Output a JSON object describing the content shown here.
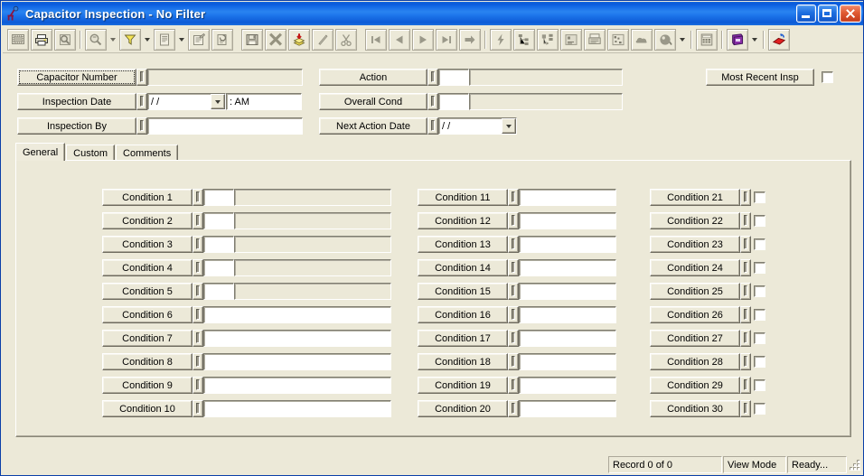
{
  "window": {
    "title": "Capacitor Inspection - No Filter",
    "app_icon": "capacitor-icon",
    "minimize_label": "Minimize",
    "maximize_label": "Maximize",
    "close_label": "Close"
  },
  "toolbar": {
    "buttons": [
      {
        "name": "screen-icon",
        "tip": "Screen"
      },
      {
        "name": "print-icon",
        "tip": "Print"
      },
      {
        "name": "print-preview-icon",
        "tip": "Print Preview"
      },
      {
        "name": "find-icon",
        "tip": "Find"
      },
      {
        "name": "filter-icon",
        "tip": "Filter"
      },
      {
        "name": "report-icon",
        "tip": "Report"
      },
      {
        "name": "properties-icon",
        "tip": "Properties"
      },
      {
        "name": "refresh-icon",
        "tip": "Refresh"
      },
      {
        "name": "save-icon",
        "tip": "Save"
      },
      {
        "name": "delete-icon",
        "tip": "Delete"
      },
      {
        "name": "add-record-icon",
        "tip": "Add Record"
      },
      {
        "name": "edit-icon",
        "tip": "Edit"
      },
      {
        "name": "cut-icon",
        "tip": "Cut"
      },
      {
        "name": "first-record-icon",
        "tip": "First Record"
      },
      {
        "name": "previous-record-icon",
        "tip": "Previous Record"
      },
      {
        "name": "next-record-icon",
        "tip": "Next Record"
      },
      {
        "name": "last-record-icon",
        "tip": "Last Record"
      },
      {
        "name": "goto-record-icon",
        "tip": "Go To Record"
      },
      {
        "name": "lightning-icon",
        "tip": "Run"
      },
      {
        "name": "tree-view-icon",
        "tip": "Tree View"
      },
      {
        "name": "layout-icon",
        "tip": "Layout"
      },
      {
        "name": "list-icon",
        "tip": "List"
      },
      {
        "name": "fax-icon",
        "tip": "Fax"
      },
      {
        "name": "image-icon",
        "tip": "Image"
      },
      {
        "name": "cloud-icon",
        "tip": "Cloud"
      },
      {
        "name": "globe-icon",
        "tip": "Web"
      },
      {
        "name": "calculator-icon",
        "tip": "Calculator"
      },
      {
        "name": "book-icon",
        "tip": "Help Book"
      },
      {
        "name": "exit-icon",
        "tip": "Exit"
      }
    ]
  },
  "header": {
    "left_fields": [
      {
        "label": "Capacitor Number",
        "value": "",
        "focused": true,
        "type": "readonly"
      },
      {
        "label": "Inspection Date",
        "value": "  /  /",
        "time_value": "  :    AM",
        "type": "date-time"
      },
      {
        "label": "Inspection By",
        "value": "",
        "type": "text"
      }
    ],
    "middle_fields": [
      {
        "label": "Action",
        "code_value": "",
        "desc_value": "",
        "type": "code-desc"
      },
      {
        "label": "Overall Cond",
        "code_value": "",
        "desc_value": "",
        "type": "code-desc"
      },
      {
        "label": "Next Action Date",
        "value": "  /  /",
        "type": "date"
      }
    ],
    "most_recent": {
      "label": "Most Recent Insp",
      "checked": false
    }
  },
  "tabs": [
    {
      "label": "General",
      "active": true
    },
    {
      "label": "Custom",
      "active": false
    },
    {
      "label": "Comments",
      "active": false
    }
  ],
  "conditions": {
    "column1": [
      {
        "label": "Condition 1",
        "code_value": "",
        "desc_value": "",
        "style": "code-desc"
      },
      {
        "label": "Condition 2",
        "code_value": "",
        "desc_value": "",
        "style": "code-desc"
      },
      {
        "label": "Condition 3",
        "code_value": "",
        "desc_value": "",
        "style": "code-desc"
      },
      {
        "label": "Condition 4",
        "code_value": "",
        "desc_value": "",
        "style": "code-desc"
      },
      {
        "label": "Condition 5",
        "code_value": "",
        "desc_value": "",
        "style": "code-desc"
      },
      {
        "label": "Condition 6",
        "value": "",
        "style": "wide-text"
      },
      {
        "label": "Condition 7",
        "value": "",
        "style": "wide-text"
      },
      {
        "label": "Condition 8",
        "value": "",
        "style": "wide-text"
      },
      {
        "label": "Condition 9",
        "value": "",
        "style": "wide-text"
      },
      {
        "label": "Condition 10",
        "value": "",
        "style": "wide-text"
      }
    ],
    "column2": [
      {
        "label": "Condition 11",
        "value": "",
        "style": "text"
      },
      {
        "label": "Condition 12",
        "value": "",
        "style": "text"
      },
      {
        "label": "Condition 13",
        "value": "",
        "style": "text"
      },
      {
        "label": "Condition 14",
        "value": "",
        "style": "text"
      },
      {
        "label": "Condition 15",
        "value": "",
        "style": "text"
      },
      {
        "label": "Condition 16",
        "value": "",
        "style": "text"
      },
      {
        "label": "Condition 17",
        "value": "",
        "style": "text"
      },
      {
        "label": "Condition 18",
        "value": "",
        "style": "text"
      },
      {
        "label": "Condition 19",
        "value": "",
        "style": "text"
      },
      {
        "label": "Condition 20",
        "value": "",
        "style": "text"
      }
    ],
    "column3": [
      {
        "label": "Condition 21",
        "checked": false,
        "style": "checkbox"
      },
      {
        "label": "Condition 22",
        "checked": false,
        "style": "checkbox"
      },
      {
        "label": "Condition 23",
        "checked": false,
        "style": "checkbox"
      },
      {
        "label": "Condition 24",
        "checked": false,
        "style": "checkbox"
      },
      {
        "label": "Condition 25",
        "checked": false,
        "style": "checkbox"
      },
      {
        "label": "Condition 26",
        "checked": false,
        "style": "checkbox"
      },
      {
        "label": "Condition 27",
        "checked": false,
        "style": "checkbox"
      },
      {
        "label": "Condition 28",
        "checked": false,
        "style": "checkbox"
      },
      {
        "label": "Condition 29",
        "checked": false,
        "style": "checkbox"
      },
      {
        "label": "Condition 30",
        "checked": false,
        "style": "checkbox"
      }
    ]
  },
  "statusbar": {
    "record": "Record 0 of 0",
    "mode": "View Mode",
    "state": "Ready...",
    "grip": "resize-grip"
  },
  "colors": {
    "titlebar_blue": "#0a59d8",
    "face": "#ece9d8",
    "field_white": "#ffffff",
    "border_dark": "#7f7d70",
    "close_red": "#c43a1a"
  }
}
